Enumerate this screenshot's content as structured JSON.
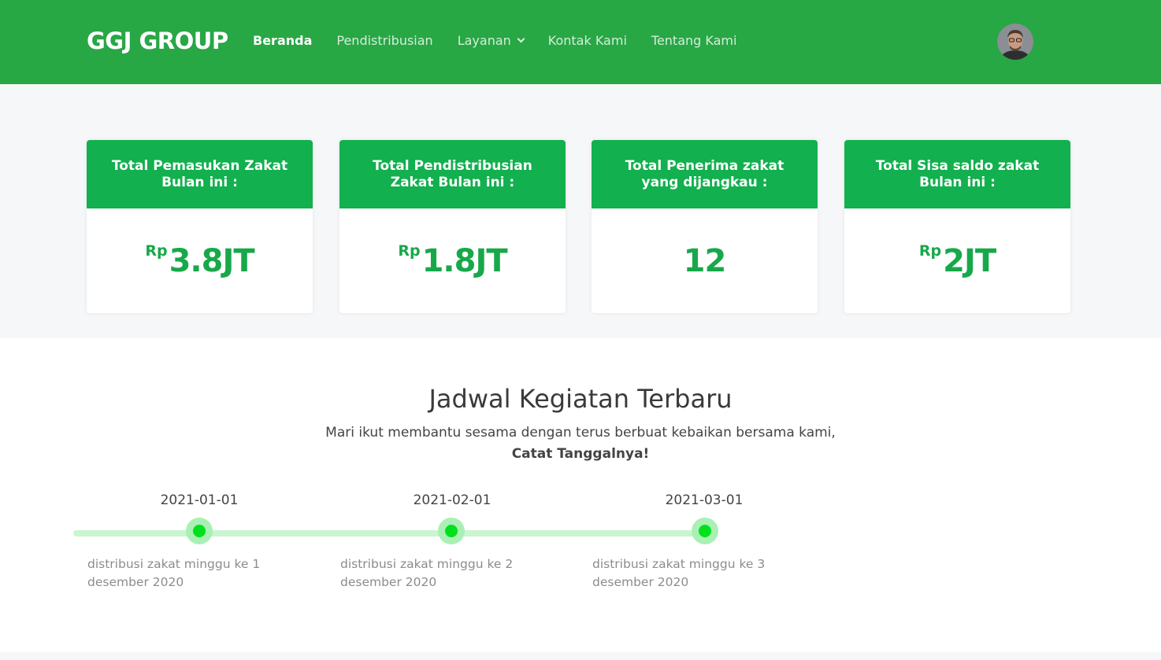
{
  "header": {
    "brand": "GGJ GROUP",
    "nav": [
      {
        "label": "Beranda",
        "active": true
      },
      {
        "label": "Pendistribusian"
      },
      {
        "label": "Layanan",
        "dropdown": true
      },
      {
        "label": "Kontak Kami"
      },
      {
        "label": "Tentang Kami"
      }
    ]
  },
  "stats": [
    {
      "title": "Total Pemasukan Zakat Bulan ini :",
      "currency": "Rp",
      "value": "3.8JT"
    },
    {
      "title": "Total Pendistribusian Zakat Bulan ini :",
      "currency": "Rp",
      "value": "1.8JT"
    },
    {
      "title": "Total Penerima zakat yang dijangkau :",
      "currency": "",
      "value": "12"
    },
    {
      "title": "Total Sisa saldo zakat Bulan ini :",
      "currency": "Rp",
      "value": "2JT"
    }
  ],
  "schedule": {
    "title": "Jadwal Kegiatan Terbaru",
    "subtitle": "Mari ikut membantu sesama dengan terus berbuat kebaikan bersama kami,",
    "subtitle_bold": "Catat Tanggalnya!",
    "items": [
      {
        "date": "2021-01-01",
        "desc": "distribusi zakat minggu ke 1 desember 2020"
      },
      {
        "date": "2021-02-01",
        "desc": "distribusi zakat minggu ke 2 desember 2020"
      },
      {
        "date": "2021-03-01",
        "desc": "distribusi zakat minggu ke 3 desember 2020"
      }
    ]
  },
  "colors": {
    "navbar": "#28a745",
    "card_header": "#12b04e",
    "value_text": "#18a84a",
    "timeline_track": "#c9f5cf",
    "timeline_dot": "#00e01c"
  }
}
